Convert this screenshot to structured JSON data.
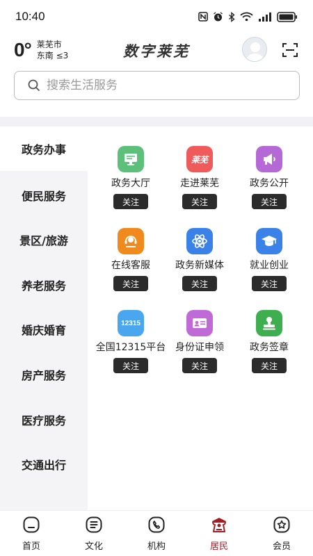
{
  "status_bar": {
    "time": "10:40",
    "icons": [
      "nfc-icon",
      "alarm-icon",
      "bluetooth-icon",
      "wifi-icon",
      "signal-icon",
      "battery-icon"
    ]
  },
  "header": {
    "temperature": "0°",
    "city": "莱芜市",
    "wind": "东南 ≤3",
    "title": "数字莱芜"
  },
  "search": {
    "placeholder": "搜索生活服务"
  },
  "sidebar": {
    "items": [
      {
        "label": "政务办事",
        "active": true
      },
      {
        "label": "便民服务",
        "active": false
      },
      {
        "label": "景区/旅游",
        "active": false
      },
      {
        "label": "养老服务",
        "active": false
      },
      {
        "label": "婚庆婚育",
        "active": false
      },
      {
        "label": "房产服务",
        "active": false
      },
      {
        "label": "医疗服务",
        "active": false
      },
      {
        "label": "交通出行",
        "active": false
      }
    ]
  },
  "services": [
    {
      "label": "政务大厅",
      "follow": "关注",
      "icon": "monitor-icon",
      "color": "#5cbf7a"
    },
    {
      "label": "走进莱芜",
      "follow": "关注",
      "icon": "laiwu-badge-icon",
      "badge_text": "莱芜",
      "color": "#ef5a5a"
    },
    {
      "label": "政务公开",
      "follow": "关注",
      "icon": "megaphone-icon",
      "color": "#b569d6"
    },
    {
      "label": "在线客服",
      "follow": "关注",
      "icon": "headset-icon",
      "color": "#f08a1c"
    },
    {
      "label": "政务新媒体",
      "follow": "关注",
      "icon": "atom-icon",
      "color": "#3a82e8"
    },
    {
      "label": "就业创业",
      "follow": "关注",
      "icon": "graduation-cap-icon",
      "color": "#3a82e8"
    },
    {
      "label": "全国12315平台",
      "follow": "关注",
      "icon": "12315-badge-icon",
      "badge_text": "12315",
      "color": "#4aa6ee"
    },
    {
      "label": "身份证申领",
      "follow": "关注",
      "icon": "id-card-icon",
      "color": "#c06ad8"
    },
    {
      "label": "政务签章",
      "follow": "关注",
      "icon": "stamp-icon",
      "color": "#3fae4f"
    }
  ],
  "bottom_nav": {
    "items": [
      {
        "label": "首页",
        "icon": "home-icon",
        "active": false
      },
      {
        "label": "文化",
        "icon": "document-icon",
        "active": false
      },
      {
        "label": "机构",
        "icon": "phone-icon",
        "active": false
      },
      {
        "label": "居民",
        "icon": "resident-icon",
        "active": true
      },
      {
        "label": "会员",
        "icon": "member-star-icon",
        "active": false
      }
    ]
  },
  "colors": {
    "accent": "#a51c24",
    "sidebar_bg": "#f4f4f6",
    "follow_button": "#2b2b2b"
  }
}
